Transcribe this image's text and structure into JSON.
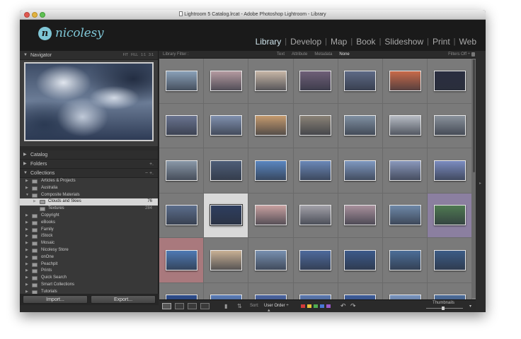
{
  "window": {
    "title": "Lightroom 5 Catalog.lrcat - Adobe Photoshop Lightroom - Library"
  },
  "logo": {
    "mark": "n",
    "text": "nicolesy"
  },
  "modules": [
    {
      "label": "Library",
      "active": true
    },
    {
      "label": "Develop",
      "active": false
    },
    {
      "label": "Map",
      "active": false
    },
    {
      "label": "Book",
      "active": false
    },
    {
      "label": "Slideshow",
      "active": false
    },
    {
      "label": "Print",
      "active": false
    },
    {
      "label": "Web",
      "active": false
    }
  ],
  "navigator": {
    "title": "Navigator",
    "options": [
      "FIT",
      "FILL",
      "1:1",
      "3:1"
    ]
  },
  "panels": {
    "catalog": "Catalog",
    "folders": "Folders",
    "folders_action": "+.",
    "collections": "Collections",
    "collections_actions": "− +."
  },
  "collections": [
    {
      "label": "Articles & Projects",
      "level": 0,
      "count": ""
    },
    {
      "label": "Australia",
      "level": 0,
      "count": ""
    },
    {
      "label": "Composite Materials",
      "level": 0,
      "count": "",
      "expanded": true
    },
    {
      "label": "Clouds and Skies",
      "level": 1,
      "count": "76",
      "selected": true
    },
    {
      "label": "Textures",
      "level": 1,
      "count": "284"
    },
    {
      "label": "Copyright",
      "level": 0,
      "count": ""
    },
    {
      "label": "eBooks",
      "level": 0,
      "count": ""
    },
    {
      "label": "Family",
      "level": 0,
      "count": ""
    },
    {
      "label": "iStock",
      "level": 0,
      "count": ""
    },
    {
      "label": "Mosaic",
      "level": 0,
      "count": ""
    },
    {
      "label": "Nicolesy Store",
      "level": 0,
      "count": ""
    },
    {
      "label": "onOne",
      "level": 0,
      "count": ""
    },
    {
      "label": "Peachpit",
      "level": 0,
      "count": ""
    },
    {
      "label": "Prints",
      "level": 0,
      "count": ""
    },
    {
      "label": "Quick Search",
      "level": 0,
      "count": ""
    },
    {
      "label": "Smart Collections",
      "level": 0,
      "count": ""
    },
    {
      "label": "Tutorials",
      "level": 0,
      "count": ""
    }
  ],
  "left_buttons": {
    "import": "Import...",
    "export": "Export..."
  },
  "filter_bar": {
    "label": "Library Filter :",
    "options": [
      {
        "label": "Text",
        "active": false
      },
      {
        "label": "Attribute",
        "active": false
      },
      {
        "label": "Metadata",
        "active": false
      },
      {
        "label": "None",
        "active": true
      }
    ],
    "status": "Filters Off ÷"
  },
  "grid": {
    "thumbnails": [
      "#8aa0b8",
      "#b49aa0",
      "#c7b6a6",
      "#6f5f78",
      "#5e6a86",
      "#c86a4a",
      "#2a2e40",
      "#6a7490",
      "#8090ae",
      "#c49a6e",
      "#8a8276",
      "#8090a2",
      "#b7bcc4",
      "#8a929c",
      "#8a98a8",
      "#4e5e78",
      "#5a86c0",
      "#6b88b8",
      "#7f98c0",
      "#8a98bc",
      "#7b8cc0",
      "#5c6e8c",
      "#2e3e60",
      "#c8a0a0",
      "#a2a0a8",
      "#a8909c",
      "#6e88a8",
      "#4f7a52",
      "#4e7ab4",
      "#c8b094",
      "#7890b0",
      "#4e6a9c",
      "#3c5a8a",
      "#4c6e98",
      "#3c5c86",
      "#2c4c8c",
      "#5a7cb8",
      "#4a64a0",
      "#5a78b0",
      "#3c5c9a",
      "#7894c0",
      "#4c6c9a"
    ],
    "selected_index": 22,
    "red_index": 28,
    "purple_index": 27
  },
  "toolbar": {
    "sort_label": "Sort:",
    "sort_value": "User Order ÷",
    "label_colors": [
      "#d23b3b",
      "#e8c43a",
      "#4fae4f",
      "#4a78d6",
      "#9c58c8"
    ],
    "thumbnails_label": "Thumbnails",
    "menu": "▾"
  }
}
